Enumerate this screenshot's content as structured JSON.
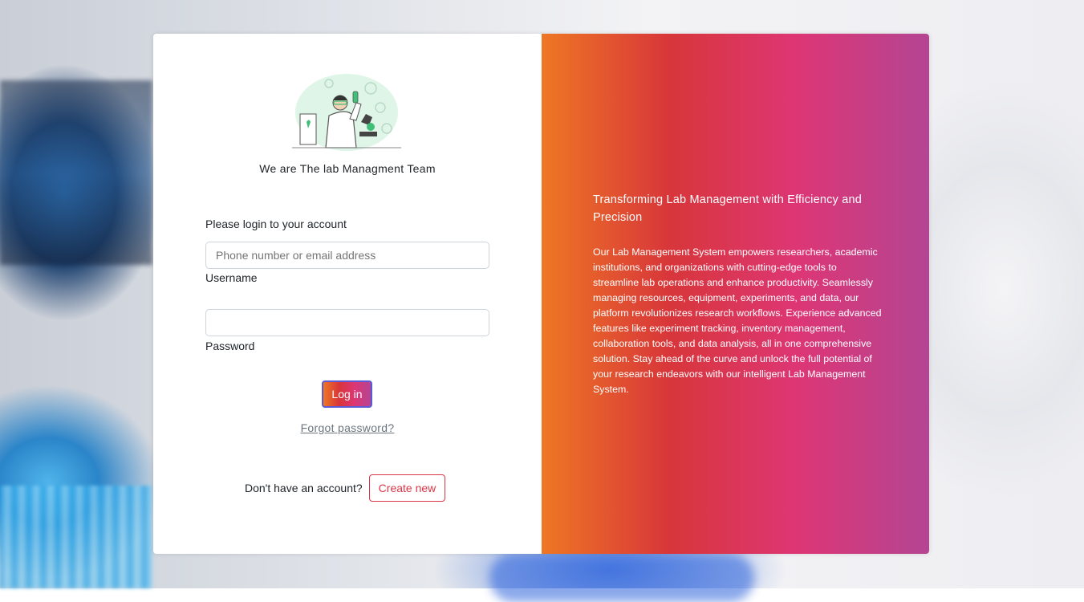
{
  "team_heading": "We are The lab Managment Team",
  "login": {
    "prompt": "Please login to your account",
    "username_placeholder": "Phone number or email address",
    "username_value": "",
    "username_label": "Username",
    "password_value": "",
    "password_label": "Password",
    "submit_label": "Log in",
    "forgot_label": "Forgot password?"
  },
  "signup": {
    "text": "Don't have an account?",
    "button_label": "Create new"
  },
  "promo": {
    "title": "Transforming Lab Management with Efficiency and Precision",
    "body": "Our Lab Management System empowers researchers, academic institutions, and organizations with cutting-edge tools to streamline lab operations and enhance productivity. Seamlessly managing resources, equipment, experiments, and data, our platform revolutionizes research workflows. Experience advanced features like experiment tracking, inventory management, collaboration tools, and data analysis, all in one comprehensive solution. Stay ahead of the curve and unlock the full potential of your research endeavors with our intelligent Lab Management System."
  },
  "colors": {
    "gradient": [
      "#ee7724",
      "#d8363a",
      "#dd3675",
      "#b44593"
    ],
    "create_border": "#dc3545",
    "illustration_accent": "#3fbf78"
  }
}
